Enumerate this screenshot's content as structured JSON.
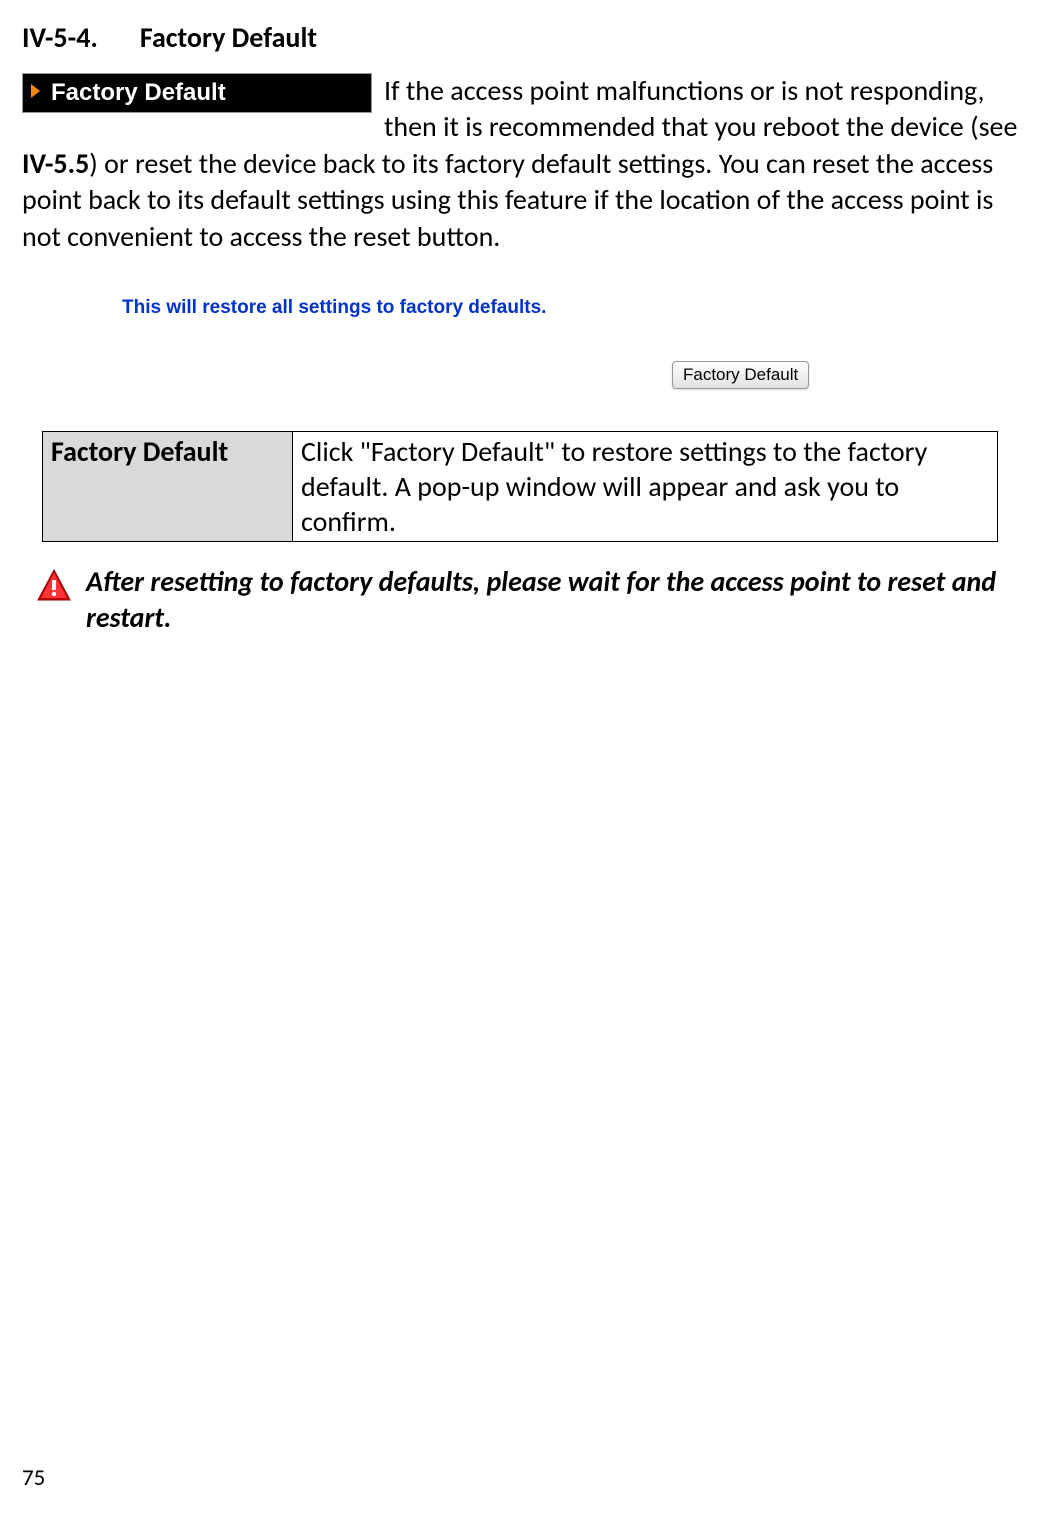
{
  "heading": {
    "number": "IV-5-4.",
    "title": "Factory Default"
  },
  "menu_item": {
    "label": "Factory Default"
  },
  "paragraph": {
    "part1": "If the access point malfunctions or is not responding, then it is recommended that you reboot the device (see ",
    "bold_ref": "IV-5.5",
    "part2": ") or reset the device back to its factory default settings. You can reset the access point back to its default settings using this feature if the location of the access point is not convenient to access the reset button."
  },
  "ui_preview": {
    "message": "This will restore all settings to factory defaults.",
    "button_label": "Factory Default"
  },
  "table": {
    "param_name": "Factory Default",
    "param_desc": "Click \"Factory Default\" to restore settings to the factory default. A pop-up window will appear and ask you to confirm."
  },
  "note": {
    "text": "After resetting to factory defaults, please wait for the access point to reset and restart."
  },
  "page_number": "75"
}
